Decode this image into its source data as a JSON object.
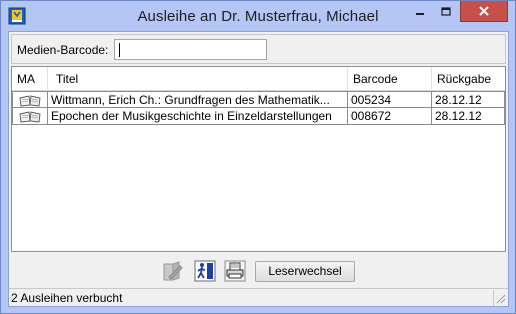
{
  "window": {
    "title": "Ausleihe an Dr. Musterfrau, Michael"
  },
  "barcode": {
    "label": "Medien-Barcode:",
    "value": ""
  },
  "list": {
    "columns": [
      "MA",
      "Titel",
      "Barcode",
      "Rückgabe"
    ],
    "rows": [
      {
        "icon": "book-icon",
        "title": "Wittmann, Erich Ch.: Grundfragen des Mathematik...",
        "barcode": "005234",
        "due": "28.12.12"
      },
      {
        "icon": "book-icon",
        "title": "Epochen der Musikgeschichte in Einzeldarstellungen",
        "barcode": "008672",
        "due": "28.12.12"
      }
    ]
  },
  "toolbar": {
    "leserwechsel_label": "Leserwechsel",
    "icons": [
      "edit-book-icon",
      "exit-door-icon",
      "printer-icon"
    ]
  },
  "status": {
    "text": "2 Ausleihen verbucht"
  },
  "colors": {
    "titlebar": "#b3c6f5",
    "close_button": "#c7504a",
    "client_bg": "#f0f0f0"
  }
}
